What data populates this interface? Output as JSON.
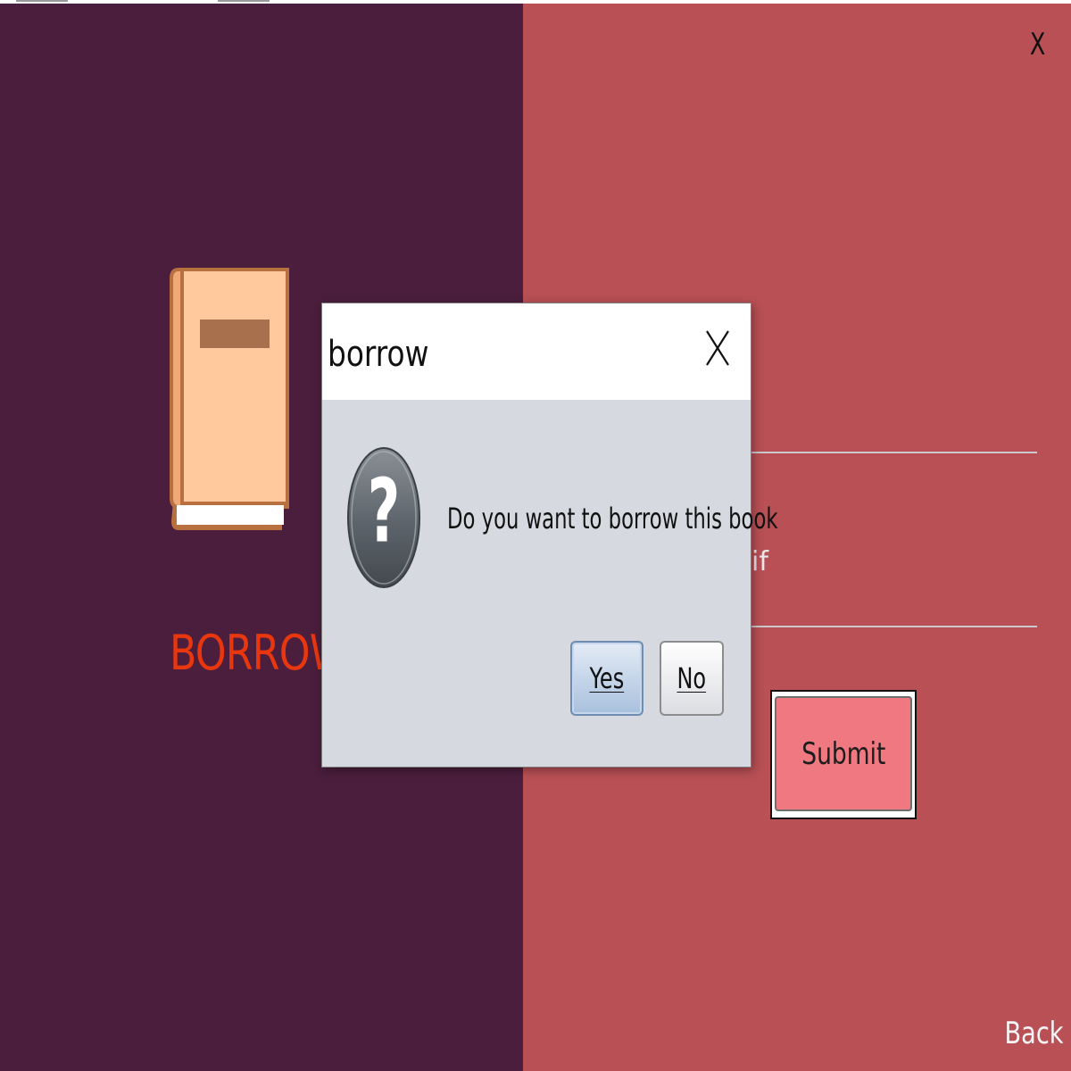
{
  "window": {
    "close_label": "X",
    "back_label": "Back"
  },
  "left_panel": {
    "icon": "book-icon",
    "title": "BORROW"
  },
  "right_panel": {
    "partial_field_text": "if",
    "submit_label": "Submit"
  },
  "dialog": {
    "title": "borrow",
    "close_label": "X",
    "icon": "question-icon",
    "message": "Do you want to borrow this book",
    "yes_label": "Yes",
    "no_label": "No"
  },
  "colors": {
    "left_panel_bg": "#4a1e3c",
    "right_panel_bg": "#b85055",
    "borrow_title": "#e8370f",
    "submit_bg": "#f07880",
    "dialog_bg": "#d6d9e0"
  }
}
